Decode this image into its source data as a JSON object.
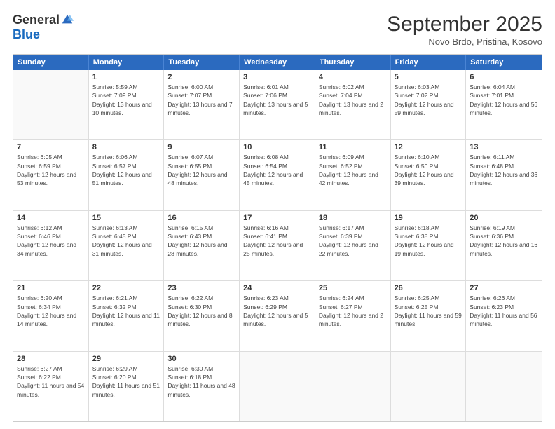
{
  "logo": {
    "general": "General",
    "blue": "Blue"
  },
  "title": "September 2025",
  "location": "Novo Brdo, Pristina, Kosovo",
  "weekdays": [
    "Sunday",
    "Monday",
    "Tuesday",
    "Wednesday",
    "Thursday",
    "Friday",
    "Saturday"
  ],
  "weeks": [
    [
      {
        "day": "",
        "sunrise": "",
        "sunset": "",
        "daylight": ""
      },
      {
        "day": "1",
        "sunrise": "Sunrise: 5:59 AM",
        "sunset": "Sunset: 7:09 PM",
        "daylight": "Daylight: 13 hours and 10 minutes."
      },
      {
        "day": "2",
        "sunrise": "Sunrise: 6:00 AM",
        "sunset": "Sunset: 7:07 PM",
        "daylight": "Daylight: 13 hours and 7 minutes."
      },
      {
        "day": "3",
        "sunrise": "Sunrise: 6:01 AM",
        "sunset": "Sunset: 7:06 PM",
        "daylight": "Daylight: 13 hours and 5 minutes."
      },
      {
        "day": "4",
        "sunrise": "Sunrise: 6:02 AM",
        "sunset": "Sunset: 7:04 PM",
        "daylight": "Daylight: 13 hours and 2 minutes."
      },
      {
        "day": "5",
        "sunrise": "Sunrise: 6:03 AM",
        "sunset": "Sunset: 7:02 PM",
        "daylight": "Daylight: 12 hours and 59 minutes."
      },
      {
        "day": "6",
        "sunrise": "Sunrise: 6:04 AM",
        "sunset": "Sunset: 7:01 PM",
        "daylight": "Daylight: 12 hours and 56 minutes."
      }
    ],
    [
      {
        "day": "7",
        "sunrise": "Sunrise: 6:05 AM",
        "sunset": "Sunset: 6:59 PM",
        "daylight": "Daylight: 12 hours and 53 minutes."
      },
      {
        "day": "8",
        "sunrise": "Sunrise: 6:06 AM",
        "sunset": "Sunset: 6:57 PM",
        "daylight": "Daylight: 12 hours and 51 minutes."
      },
      {
        "day": "9",
        "sunrise": "Sunrise: 6:07 AM",
        "sunset": "Sunset: 6:55 PM",
        "daylight": "Daylight: 12 hours and 48 minutes."
      },
      {
        "day": "10",
        "sunrise": "Sunrise: 6:08 AM",
        "sunset": "Sunset: 6:54 PM",
        "daylight": "Daylight: 12 hours and 45 minutes."
      },
      {
        "day": "11",
        "sunrise": "Sunrise: 6:09 AM",
        "sunset": "Sunset: 6:52 PM",
        "daylight": "Daylight: 12 hours and 42 minutes."
      },
      {
        "day": "12",
        "sunrise": "Sunrise: 6:10 AM",
        "sunset": "Sunset: 6:50 PM",
        "daylight": "Daylight: 12 hours and 39 minutes."
      },
      {
        "day": "13",
        "sunrise": "Sunrise: 6:11 AM",
        "sunset": "Sunset: 6:48 PM",
        "daylight": "Daylight: 12 hours and 36 minutes."
      }
    ],
    [
      {
        "day": "14",
        "sunrise": "Sunrise: 6:12 AM",
        "sunset": "Sunset: 6:46 PM",
        "daylight": "Daylight: 12 hours and 34 minutes."
      },
      {
        "day": "15",
        "sunrise": "Sunrise: 6:13 AM",
        "sunset": "Sunset: 6:45 PM",
        "daylight": "Daylight: 12 hours and 31 minutes."
      },
      {
        "day": "16",
        "sunrise": "Sunrise: 6:15 AM",
        "sunset": "Sunset: 6:43 PM",
        "daylight": "Daylight: 12 hours and 28 minutes."
      },
      {
        "day": "17",
        "sunrise": "Sunrise: 6:16 AM",
        "sunset": "Sunset: 6:41 PM",
        "daylight": "Daylight: 12 hours and 25 minutes."
      },
      {
        "day": "18",
        "sunrise": "Sunrise: 6:17 AM",
        "sunset": "Sunset: 6:39 PM",
        "daylight": "Daylight: 12 hours and 22 minutes."
      },
      {
        "day": "19",
        "sunrise": "Sunrise: 6:18 AM",
        "sunset": "Sunset: 6:38 PM",
        "daylight": "Daylight: 12 hours and 19 minutes."
      },
      {
        "day": "20",
        "sunrise": "Sunrise: 6:19 AM",
        "sunset": "Sunset: 6:36 PM",
        "daylight": "Daylight: 12 hours and 16 minutes."
      }
    ],
    [
      {
        "day": "21",
        "sunrise": "Sunrise: 6:20 AM",
        "sunset": "Sunset: 6:34 PM",
        "daylight": "Daylight: 12 hours and 14 minutes."
      },
      {
        "day": "22",
        "sunrise": "Sunrise: 6:21 AM",
        "sunset": "Sunset: 6:32 PM",
        "daylight": "Daylight: 12 hours and 11 minutes."
      },
      {
        "day": "23",
        "sunrise": "Sunrise: 6:22 AM",
        "sunset": "Sunset: 6:30 PM",
        "daylight": "Daylight: 12 hours and 8 minutes."
      },
      {
        "day": "24",
        "sunrise": "Sunrise: 6:23 AM",
        "sunset": "Sunset: 6:29 PM",
        "daylight": "Daylight: 12 hours and 5 minutes."
      },
      {
        "day": "25",
        "sunrise": "Sunrise: 6:24 AM",
        "sunset": "Sunset: 6:27 PM",
        "daylight": "Daylight: 12 hours and 2 minutes."
      },
      {
        "day": "26",
        "sunrise": "Sunrise: 6:25 AM",
        "sunset": "Sunset: 6:25 PM",
        "daylight": "Daylight: 11 hours and 59 minutes."
      },
      {
        "day": "27",
        "sunrise": "Sunrise: 6:26 AM",
        "sunset": "Sunset: 6:23 PM",
        "daylight": "Daylight: 11 hours and 56 minutes."
      }
    ],
    [
      {
        "day": "28",
        "sunrise": "Sunrise: 6:27 AM",
        "sunset": "Sunset: 6:22 PM",
        "daylight": "Daylight: 11 hours and 54 minutes."
      },
      {
        "day": "29",
        "sunrise": "Sunrise: 6:29 AM",
        "sunset": "Sunset: 6:20 PM",
        "daylight": "Daylight: 11 hours and 51 minutes."
      },
      {
        "day": "30",
        "sunrise": "Sunrise: 6:30 AM",
        "sunset": "Sunset: 6:18 PM",
        "daylight": "Daylight: 11 hours and 48 minutes."
      },
      {
        "day": "",
        "sunrise": "",
        "sunset": "",
        "daylight": ""
      },
      {
        "day": "",
        "sunrise": "",
        "sunset": "",
        "daylight": ""
      },
      {
        "day": "",
        "sunrise": "",
        "sunset": "",
        "daylight": ""
      },
      {
        "day": "",
        "sunrise": "",
        "sunset": "",
        "daylight": ""
      }
    ]
  ]
}
